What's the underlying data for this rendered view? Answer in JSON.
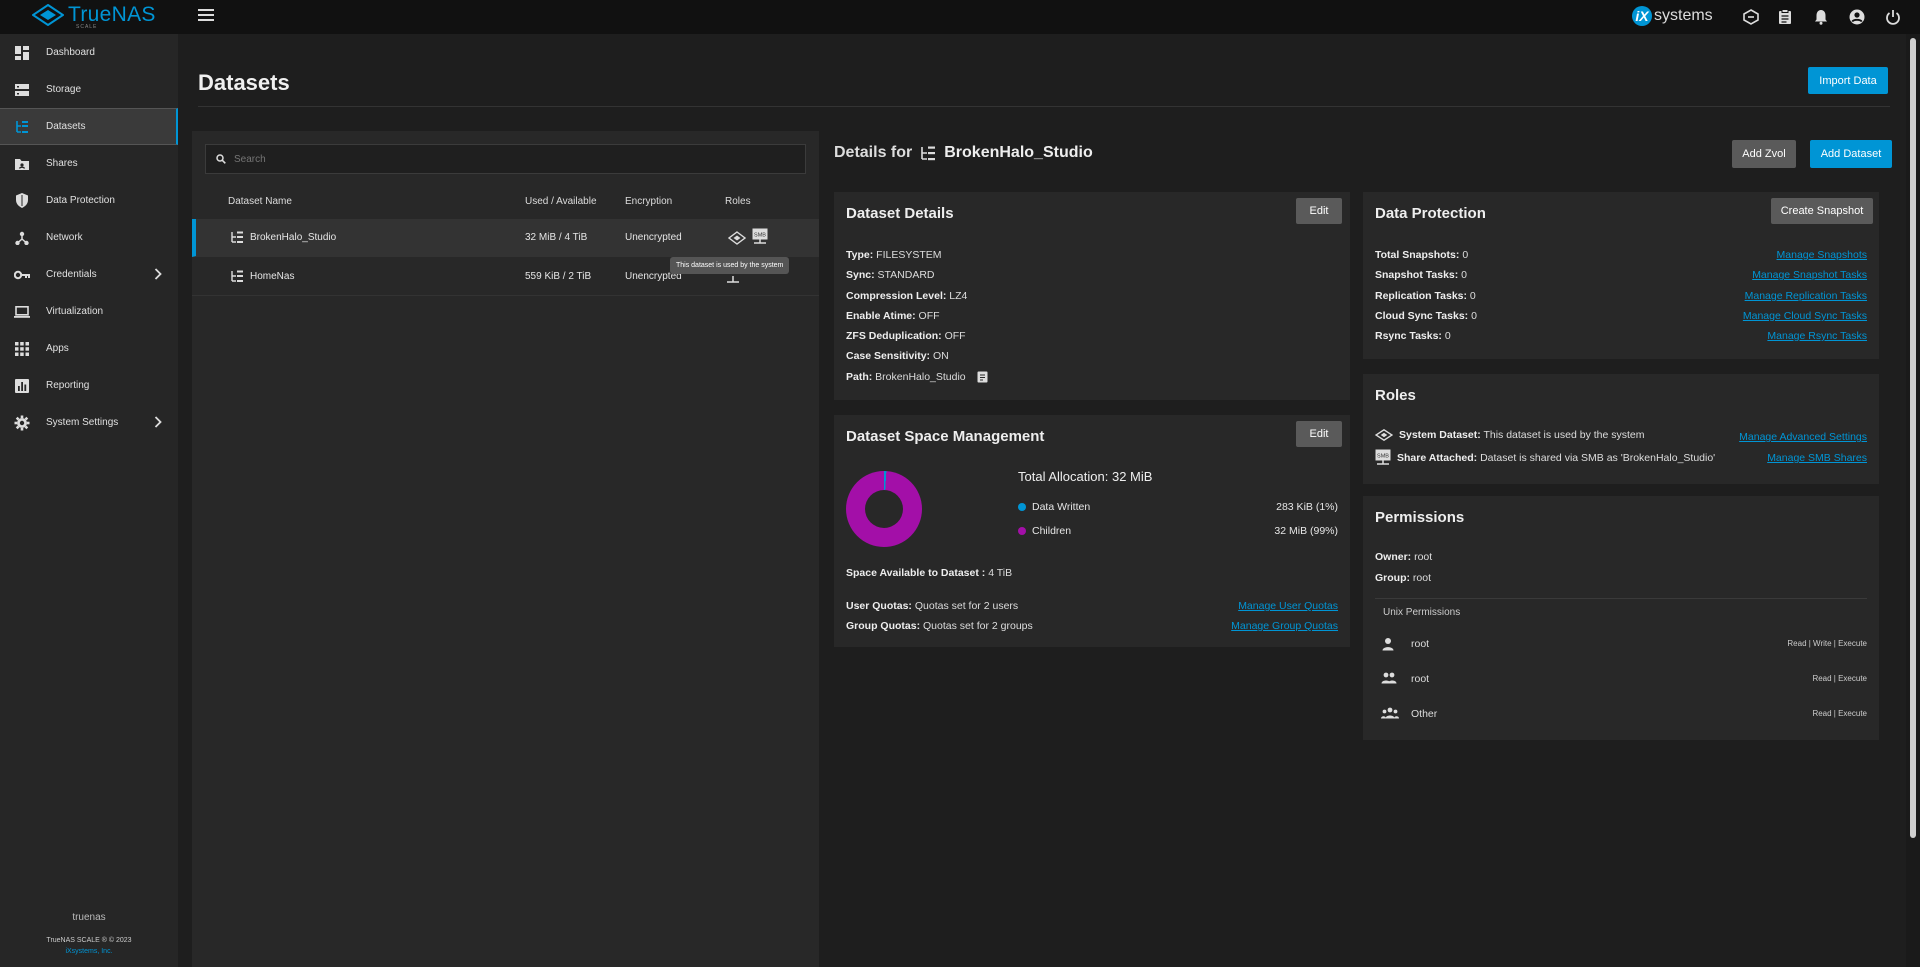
{
  "app": {
    "name": "TrueNAS",
    "edition": "SCALE",
    "vendor": "systems"
  },
  "sidebar": {
    "items": [
      {
        "label": "Dashboard",
        "icon": "dashboard-icon"
      },
      {
        "label": "Storage",
        "icon": "storage-icon"
      },
      {
        "label": "Datasets",
        "icon": "datasets-icon",
        "active": true
      },
      {
        "label": "Shares",
        "icon": "shares-icon"
      },
      {
        "label": "Data Protection",
        "icon": "shield-icon"
      },
      {
        "label": "Network",
        "icon": "network-icon"
      },
      {
        "label": "Credentials",
        "icon": "key-icon",
        "expandable": true
      },
      {
        "label": "Virtualization",
        "icon": "laptop-icon"
      },
      {
        "label": "Apps",
        "icon": "apps-grid-icon"
      },
      {
        "label": "Reporting",
        "icon": "reporting-icon"
      },
      {
        "label": "System Settings",
        "icon": "gear-icon",
        "expandable": true
      }
    ],
    "hostname": "truenas",
    "copyright": "TrueNAS SCALE ® © 2023",
    "company": "iXsystems, Inc."
  },
  "page": {
    "title": "Datasets",
    "import_label": "Import Data"
  },
  "list": {
    "search_placeholder": "Search",
    "columns": [
      "Dataset Name",
      "Used / Available",
      "Encryption",
      "Roles"
    ],
    "rows": [
      {
        "name": "BrokenHalo_Studio",
        "used": "32 MiB / 4 TiB",
        "encryption": "Unencrypted"
      },
      {
        "name": "HomeNas",
        "used": "559 KiB / 2 TiB",
        "encryption": "Unencrypted"
      }
    ],
    "tooltip": "This dataset is used by the system"
  },
  "details": {
    "prefix": "Details for",
    "dataset": "BrokenHalo_Studio",
    "add_zvol": "Add Zvol",
    "add_dataset": "Add Dataset"
  },
  "dataset_details": {
    "title": "Dataset Details",
    "edit": "Edit",
    "fields": [
      {
        "k": "Type:",
        "v": "FILESYSTEM"
      },
      {
        "k": "Sync:",
        "v": "STANDARD"
      },
      {
        "k": "Compression Level:",
        "v": "LZ4"
      },
      {
        "k": "Enable Atime:",
        "v": "OFF"
      },
      {
        "k": "ZFS Deduplication:",
        "v": "OFF"
      },
      {
        "k": "Case Sensitivity:",
        "v": "ON"
      },
      {
        "k": "Path:",
        "v": "BrokenHalo_Studio"
      }
    ]
  },
  "space": {
    "title": "Dataset Space Management",
    "edit": "Edit",
    "total_label": "Total Allocation:",
    "total_value": "32 MiB",
    "legend": [
      {
        "name": "Data Written",
        "value": "283 KiB (1%)",
        "color": "#0095d5",
        "percent": 1
      },
      {
        "name": "Children",
        "value": "32 MiB (99%)",
        "color": "#a30fa8",
        "percent": 99
      }
    ],
    "available_label": "Space Available to Dataset :",
    "available_value": "4 TiB",
    "user_quotas_label": "User Quotas:",
    "user_quotas_value": "Quotas set for 2 users",
    "user_quotas_link": "Manage User Quotas",
    "group_quotas_label": "Group Quotas:",
    "group_quotas_value": "Quotas set for 2 groups",
    "group_quotas_link": "Manage Group Quotas"
  },
  "protection": {
    "title": "Data Protection",
    "create": "Create Snapshot",
    "rows": [
      {
        "k": "Total Snapshots:",
        "v": "0",
        "link": "Manage Snapshots"
      },
      {
        "k": "Snapshot Tasks:",
        "v": "0",
        "link": "Manage Snapshot Tasks"
      },
      {
        "k": "Replication Tasks:",
        "v": "0",
        "link": "Manage Replication Tasks"
      },
      {
        "k": "Cloud Sync Tasks:",
        "v": "0",
        "link": "Manage Cloud Sync Tasks"
      },
      {
        "k": "Rsync Tasks:",
        "v": "0",
        "link": "Manage Rsync Tasks"
      }
    ]
  },
  "roles": {
    "title": "Roles",
    "rows": [
      {
        "k": "System Dataset:",
        "v": "This dataset is used by the system",
        "link": "Manage Advanced Settings"
      },
      {
        "k": "Share Attached:",
        "v": "Dataset is shared via SMB as 'BrokenHalo_Studio'",
        "link": "Manage SMB Shares"
      }
    ]
  },
  "permissions": {
    "title": "Permissions",
    "owner_label": "Owner:",
    "owner": "root",
    "group_label": "Group:",
    "group": "root",
    "unix_label": "Unix Permissions",
    "rows": [
      {
        "name": "root",
        "rights": "Read | Write | Execute",
        "icon": "user-icon"
      },
      {
        "name": "root",
        "rights": "Read | Execute",
        "icon": "group-icon"
      },
      {
        "name": "Other",
        "rights": "Read | Execute",
        "icon": "others-icon"
      }
    ]
  }
}
